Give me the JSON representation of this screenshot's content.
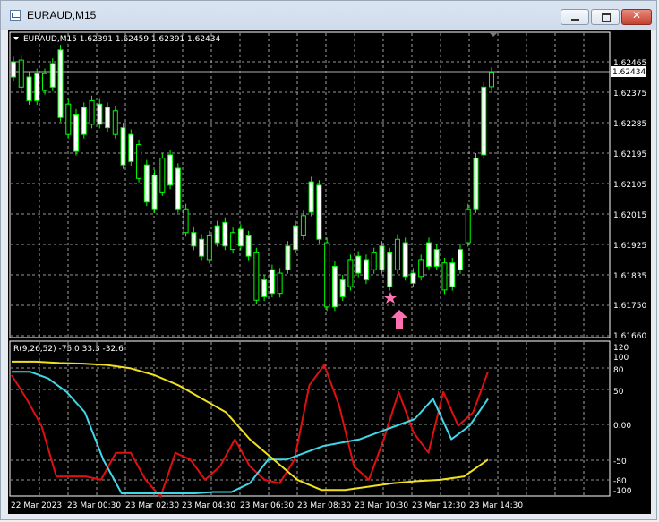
{
  "window": {
    "title": "EURAUD,M15",
    "icon": "chart-window-icon",
    "buttons": [
      "minimize-icon",
      "maximize-icon",
      "close-icon"
    ]
  },
  "main_panel": {
    "header": "EURAUD,M15  1.62391 1.62459 1.62391 1.62434",
    "current_price_label": "1.62434",
    "price_axis_labels": [
      "1.62465",
      "1.62375",
      "1.62285",
      "1.62195",
      "1.62105",
      "1.62015",
      "1.61925",
      "1.61835",
      "1.61750",
      "1.61660"
    ]
  },
  "indicator_panel": {
    "header": "R(9,26,52) -75.0 33.3 -32.6",
    "axis_labels": [
      "120",
      "100",
      "80",
      "50",
      "0.00",
      "-50",
      "-80",
      "-100"
    ]
  },
  "time_axis_labels": [
    "22 Mar 2023",
    "23 Mar 00:30",
    "23 Mar 02:30",
    "23 Mar 04:30",
    "23 Mar 06:30",
    "23 Mar 08:30",
    "23 Mar 10:30",
    "23 Mar 12:30",
    "23 Mar 14:30"
  ],
  "colors": {
    "background": "#000000",
    "grid": "#c8c8c8",
    "candle": "#00ff00",
    "candle_body": "#ffffff",
    "line_red": "#e01010",
    "line_cyan": "#40d8e8",
    "line_yellow": "#f0e020",
    "marker": "#ff70b0"
  },
  "markers": [
    "star-marker-icon",
    "up-arrow-marker-icon"
  ],
  "chart_data": {
    "type": "line",
    "title": "EURAUD,M15",
    "price_candles": [
      [
        1.62465,
        1.6242
      ],
      [
        1.6247,
        1.6239
      ],
      [
        1.6242,
        1.6235
      ],
      [
        1.6243,
        1.6235
      ],
      [
        1.6243,
        1.6238
      ],
      [
        1.6246,
        1.6239
      ],
      [
        1.625,
        1.623
      ],
      [
        1.6234,
        1.6225
      ],
      [
        1.6231,
        1.622
      ],
      [
        1.6233,
        1.6225
      ],
      [
        1.6235,
        1.6228
      ],
      [
        1.6234,
        1.6228
      ],
      [
        1.6233,
        1.6227
      ],
      [
        1.6232,
        1.6225
      ],
      [
        1.6227,
        1.6216
      ],
      [
        1.6225,
        1.6217
      ],
      [
        1.6222,
        1.6212
      ],
      [
        1.6216,
        1.6205
      ],
      [
        1.6213,
        1.6203
      ],
      [
        1.6218,
        1.6208
      ],
      [
        1.6219,
        1.621
      ],
      [
        1.6215,
        1.6203
      ],
      [
        1.6203,
        1.6196
      ],
      [
        1.6196,
        1.6192
      ],
      [
        1.6194,
        1.6189
      ],
      [
        1.6195,
        1.6188
      ],
      [
        1.6198,
        1.6193
      ],
      [
        1.6199,
        1.6192
      ],
      [
        1.6196,
        1.6191
      ],
      [
        1.6197,
        1.6192
      ],
      [
        1.6195,
        1.6189
      ],
      [
        1.619,
        1.6176
      ],
      [
        1.6182,
        1.6177
      ],
      [
        1.6185,
        1.6178
      ],
      [
        1.6184,
        1.6178
      ],
      [
        1.6192,
        1.6185
      ],
      [
        1.6198,
        1.6191
      ],
      [
        1.6201,
        1.6195
      ],
      [
        1.6211,
        1.6202
      ],
      [
        1.621,
        1.6194
      ],
      [
        1.6193,
        1.6174
      ],
      [
        1.6186,
        1.6174
      ],
      [
        1.6182,
        1.6177
      ],
      [
        1.6188,
        1.618
      ],
      [
        1.6189,
        1.6184
      ],
      [
        1.6188,
        1.6182
      ],
      [
        1.619,
        1.6185
      ],
      [
        1.6192,
        1.6185
      ],
      [
        1.619,
        1.618
      ],
      [
        1.6194,
        1.6185
      ],
      [
        1.6193,
        1.6183
      ],
      [
        1.6184,
        1.6181
      ],
      [
        1.6188,
        1.6183
      ],
      [
        1.6193,
        1.6186
      ],
      [
        1.6191,
        1.6186
      ],
      [
        1.6187,
        1.6179
      ],
      [
        1.6187,
        1.618
      ],
      [
        1.6191,
        1.6185
      ],
      [
        1.6203,
        1.6193
      ],
      [
        1.6218,
        1.6203
      ],
      [
        1.6239,
        1.6219
      ],
      [
        1.62434,
        1.62391
      ]
    ],
    "oscillator": {
      "lines": [
        {
          "color": "red",
          "values": [
            75,
            40,
            0,
            -75,
            -75,
            -75,
            -80,
            -40,
            -40,
            -80,
            -105,
            -40,
            -50,
            -80,
            -60,
            -20,
            -60,
            -80,
            -85,
            -50,
            60,
            90,
            30,
            -60,
            -80,
            -20,
            50,
            -10,
            -40,
            50,
            0,
            20,
            80
          ]
        },
        {
          "color": "cyan",
          "values": [
            80,
            80,
            70,
            50,
            20,
            -50,
            -100,
            -100,
            -100,
            -100,
            -100,
            -98,
            -98,
            -85,
            -50,
            -50,
            -40,
            -30,
            -25,
            -20,
            -10,
            0,
            10,
            40,
            -20,
            0,
            40
          ]
        },
        {
          "color": "yellow",
          "values": [
            95,
            95,
            93,
            92,
            90,
            85,
            75,
            60,
            40,
            20,
            -20,
            -50,
            -80,
            -95,
            -95,
            -90,
            -85,
            -82,
            -80,
            -75,
            -50
          ]
        }
      ],
      "ylim": [
        -100,
        120
      ]
    },
    "xlabel": "",
    "ylabel": ""
  }
}
